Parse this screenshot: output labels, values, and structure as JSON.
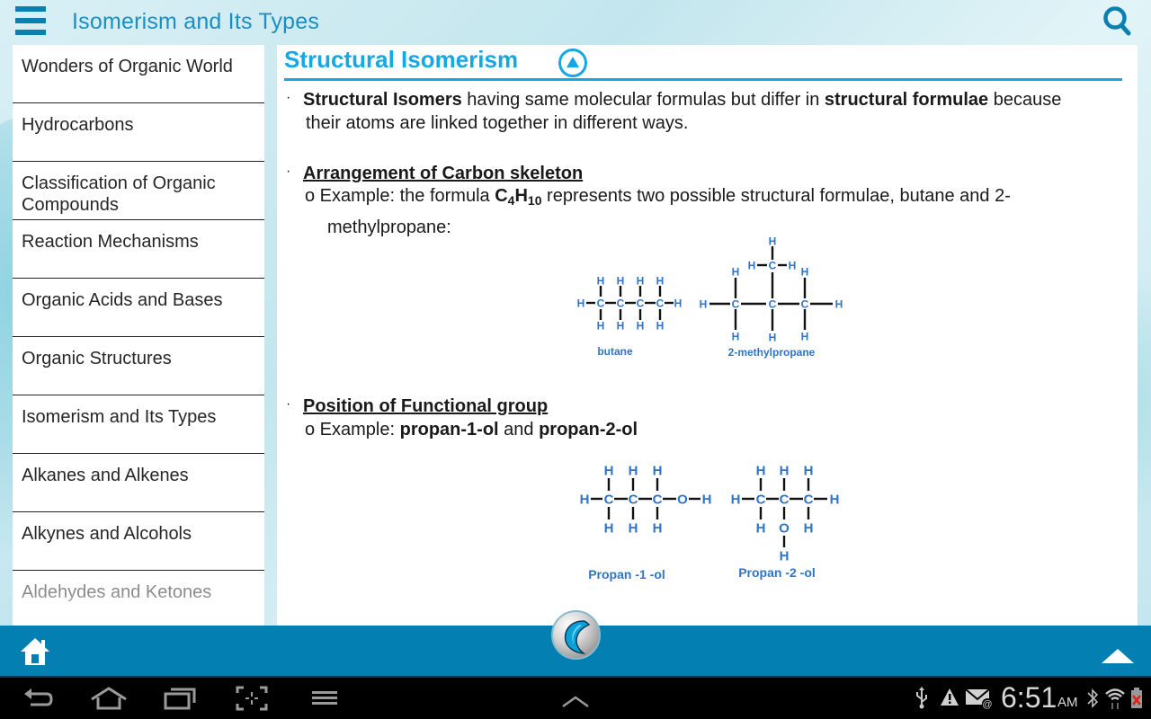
{
  "app": {
    "title": "Isomerism and Its Types",
    "accent_color": "#14a8e4",
    "bar_color": "#047fb2"
  },
  "sidebar": {
    "selected": "Isomerism and Its Types",
    "items": [
      {
        "label": "Wonders of Organic World"
      },
      {
        "label": "Hydrocarbons"
      },
      {
        "label": "Classification of Organic Compounds"
      },
      {
        "label": "Reaction Mechanisms"
      },
      {
        "label": "Organic Acids and Bases"
      },
      {
        "label": "Organic Structures"
      },
      {
        "label": "Isomerism and Its Types"
      },
      {
        "label": "Alkanes and Alkenes"
      },
      {
        "label": "Alkynes and Alcohols"
      },
      {
        "label": "Aldehydes and Ketones"
      }
    ]
  },
  "content": {
    "section_title": "Structural Isomerism",
    "intro": {
      "bold1": "Structural Isomers",
      "text1": " having same molecular formulas but differ in ",
      "bold2": "structural formulae",
      "text2": " because",
      "line2": "their atoms are linked together in different ways."
    },
    "arrangement": {
      "heading": "Arrangement of Carbon skeleton",
      "example_prefix": "o Example: the formula ",
      "formula_c": "C",
      "formula_c_sub": "4",
      "formula_h": "H",
      "formula_h_sub": "10",
      "example_suffix": " represents two possible structural formulae, butane and 2-",
      "example_line2": "methylpropane:",
      "diagram_labels": {
        "left": "butane",
        "right": "2-methylpropane"
      }
    },
    "functional": {
      "heading": "Position of Functional group",
      "example_prefix": "o Example: ",
      "bold1": "propan-1-ol",
      "mid": " and ",
      "bold2": "propan-2-ol",
      "diagram_labels": {
        "left": "Propan -1 -ol",
        "right": "Propan -2 -ol"
      }
    },
    "atoms": {
      "C": "C",
      "H": "H",
      "O": "O"
    }
  },
  "status_bar": {
    "time": "6:51",
    "ampm": "AM",
    "icons": [
      "usb-icon",
      "warning-icon",
      "email-icon",
      "bluetooth-icon",
      "wifi-icon",
      "battery-icon"
    ]
  },
  "nav_icons": [
    "back-icon",
    "home-icon",
    "recent-apps-icon",
    "screenshot-icon",
    "menu-icon",
    "show-more-icon"
  ]
}
